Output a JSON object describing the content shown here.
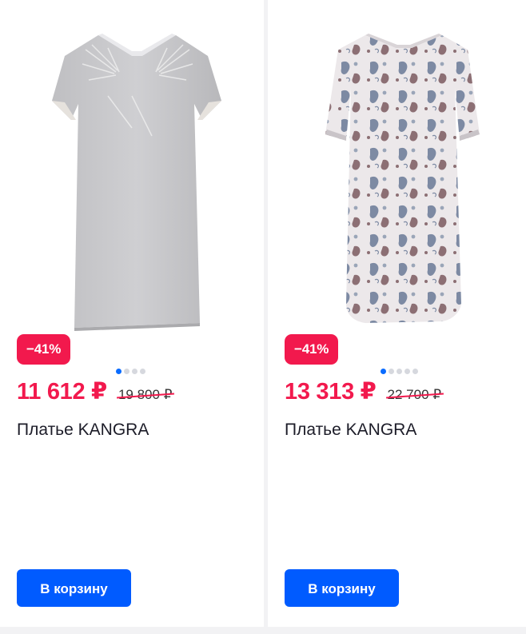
{
  "products": [
    {
      "discount": "−41%",
      "price": "11 612 ₽",
      "old_price": "19 800 ₽",
      "title": "Платье KANGRA",
      "cart_label": "В корзину",
      "image_dots": 4,
      "active_dot": 0,
      "image_name": "grey-dress-image"
    },
    {
      "discount": "−41%",
      "price": "13 313 ₽",
      "old_price": "22 700 ₽",
      "title": "Платье KANGRA",
      "cart_label": "В корзину",
      "image_dots": 5,
      "active_dot": 0,
      "image_name": "paisley-dress-image"
    }
  ],
  "colors": {
    "accent": "#f2194d",
    "button": "#005bff",
    "dot_active": "#0a6cff",
    "dot_inactive": "#d6d8de"
  }
}
